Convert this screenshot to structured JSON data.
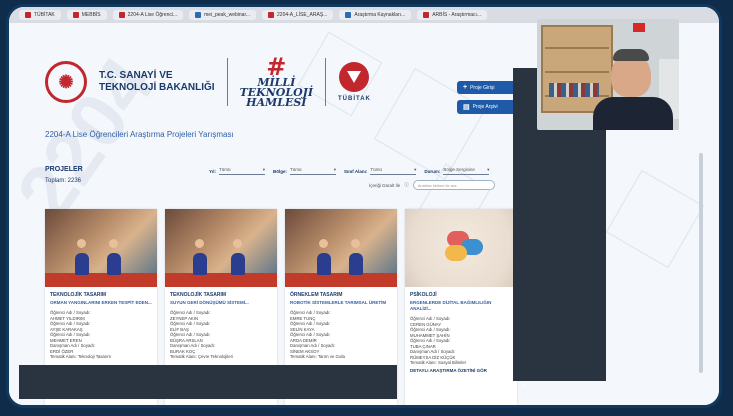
{
  "browser": {
    "tabs": [
      {
        "label": "TÜBİTAK"
      },
      {
        "label": "MEBBİS"
      },
      {
        "label": "2204-A Lise Öğrenci..."
      },
      {
        "label": "mei_peak_webinar..."
      },
      {
        "label": "2204-A_LİSE_ARAŞ..."
      },
      {
        "label": "Araştırma Kaynakları..."
      },
      {
        "label": "ARBİS - Araştırmacı..."
      }
    ]
  },
  "header": {
    "ministry_line1": "T.C. SANAYİ VE",
    "ministry_line2": "TEKNOLOJİ BAKANLIĞI",
    "milli_hash": "#",
    "milli_line1": "MİLLİ",
    "milli_line2": "TEKNOLOJİ",
    "milli_line3": "HAMLESİ",
    "tubitak": "TÜBİTAK"
  },
  "side_buttons": [
    {
      "label": "Proje Girişi"
    },
    {
      "label": "Proje Arşivi"
    }
  ],
  "competition_title": "2204-A Lise Öğrencileri Araştırma Projeleri Yarışması",
  "projects": {
    "label": "PROJELER",
    "count": "Toplam: 2236"
  },
  "filters": [
    {
      "label": "Yıl:",
      "value": "Tümü"
    },
    {
      "label": "Bölge:",
      "value": "Tümü"
    },
    {
      "label": "Sınıf Alanı:",
      "value": "Tümü"
    },
    {
      "label": "Durum:",
      "value": "Bölge Sergisine"
    }
  ],
  "search": {
    "label": "İçeriği Daralt İle",
    "placeholder": "Anahtar kelime ile ara"
  },
  "cards": [
    {
      "category": "TEKNOLOJİK TASARIM",
      "title": "ORMAN YANGINLARINI ERKEN TESPİT EDEN...",
      "lines": [
        "Öğrenci Adı / Soyadı:",
        "AHMET YILDIRIM",
        "Öğrenci Adı / Soyadı:",
        "AYŞE KARAKAŞ",
        "Öğrenci Adı / Soyadı:",
        "MEHMET EREN",
        "Danışman Adı / Soyadı:",
        "ERDİ ÖZER"
      ],
      "field": "Tematik Alanı: Teknoloji Tasarım"
    },
    {
      "category": "TEKNOLOJİK TASARIM",
      "title": "SUYUN GERİ DÖNÜŞÜMÜ SİSTEMİ...",
      "lines": [
        "Öğrenci Adı / Soyadı:",
        "ZEYNEP AKIN",
        "Öğrenci Adı / Soyadı:",
        "ELİF BAŞ",
        "Öğrenci Adı / Soyadı:",
        "BÜŞRA ARSLAN",
        "Danışman Adı / Soyadı:",
        "BURAK KOÇ"
      ],
      "field": "Tematik Alanı: Çevre Teknolojileri"
    },
    {
      "category": "ÖRNEKLEM TASARIM",
      "title": "ROBOTİK SİSTEMLERLE TARIMSAL ÜRETİM",
      "lines": [
        "Öğrenci Adı / Soyadı:",
        "EMRE TUNÇ",
        "Öğrenci Adı / Soyadı:",
        "SELİN KAYA",
        "Öğrenci Adı / Soyadı:",
        "ARDA DEMİR",
        "Danışman Adı / Soyadı:",
        "SİNEM AKSOY"
      ],
      "field": "Tematik Alanı: Tarım ve Gıda"
    },
    {
      "category": "PSİKOLOJİ",
      "title": "ERGENLERDE DİJİTAL BAĞIMLILIĞIN ANALİZİ...",
      "lines": [
        "Öğrenci Adı / Soyadı:",
        "CEREN GÜNAY",
        "Öğrenci Adı / Soyadı:",
        "MUHAMMET ŞAHİN",
        "Öğrenci Adı / Soyadı:",
        "TUBA ÇINAR",
        "Danışman Adı / Soyadı:",
        "RÜMEYSA DİZ KÜÇÜK"
      ],
      "field": "Tematik Alanı: Sosyal Bilimler"
    }
  ],
  "card_more_label": "DETAYLI ARAŞTIRMA ÖZETİNİ GÖR",
  "next_arrow": "›",
  "watermark": "2204"
}
